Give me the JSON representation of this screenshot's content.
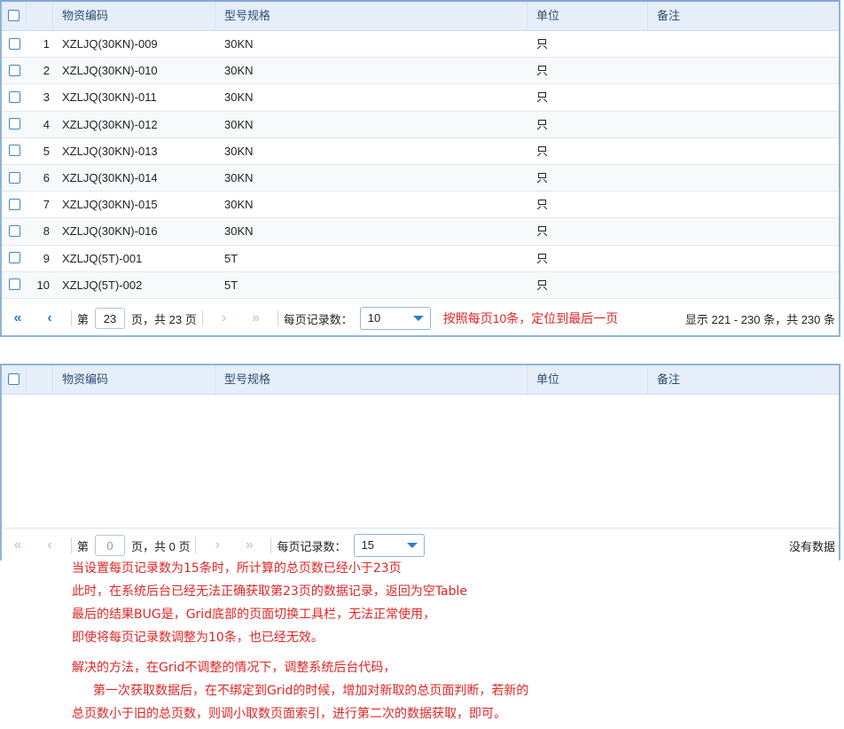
{
  "grid1": {
    "headers": {
      "code": "物资编码",
      "model": "型号规格",
      "unit": "单位",
      "remark": "备注"
    },
    "rows": [
      {
        "num": "1",
        "code": "XZLJQ(30KN)-009",
        "model": "30KN",
        "unit": "只",
        "remark": ""
      },
      {
        "num": "2",
        "code": "XZLJQ(30KN)-010",
        "model": "30KN",
        "unit": "只",
        "remark": ""
      },
      {
        "num": "3",
        "code": "XZLJQ(30KN)-011",
        "model": "30KN",
        "unit": "只",
        "remark": ""
      },
      {
        "num": "4",
        "code": "XZLJQ(30KN)-012",
        "model": "30KN",
        "unit": "只",
        "remark": ""
      },
      {
        "num": "5",
        "code": "XZLJQ(30KN)-013",
        "model": "30KN",
        "unit": "只",
        "remark": ""
      },
      {
        "num": "6",
        "code": "XZLJQ(30KN)-014",
        "model": "30KN",
        "unit": "只",
        "remark": ""
      },
      {
        "num": "7",
        "code": "XZLJQ(30KN)-015",
        "model": "30KN",
        "unit": "只",
        "remark": ""
      },
      {
        "num": "8",
        "code": "XZLJQ(30KN)-016",
        "model": "30KN",
        "unit": "只",
        "remark": ""
      },
      {
        "num": "9",
        "code": "XZLJQ(5T)-001",
        "model": "5T",
        "unit": "只",
        "remark": ""
      },
      {
        "num": "10",
        "code": "XZLJQ(5T)-002",
        "model": "5T",
        "unit": "只",
        "remark": ""
      }
    ],
    "pager": {
      "page_prefix": "第",
      "page_value": "23",
      "page_suffix": "页，共 23 页",
      "page_size_label": "每页记录数：",
      "page_size_value": "10",
      "annotation": "按照每页10条，定位到最后一页",
      "info": "显示 221 - 230 条，共 230 条"
    }
  },
  "grid2": {
    "headers": {
      "code": "物资编码",
      "model": "型号规格",
      "unit": "单位",
      "remark": "备注"
    },
    "pager": {
      "page_prefix": "第",
      "page_value": "0",
      "page_suffix": "页，共 0 页",
      "page_size_label": "每页记录数：",
      "page_size_value": "15",
      "info": "没有数据"
    }
  },
  "notes": {
    "line1": "当设置每页记录数为15条时，所计算的总页数已经小于23页",
    "line2": "此时，在系统后台已经无法正确获取第23页的数据记录，返回为空Table",
    "line3": "最后的结果BUG是，Grid底部的页面切换工具栏，无法正常使用，",
    "line4": "即使将每页记录数调整为10条，也已经无效。",
    "line5": "解决的方法，在Grid不调整的情况下，调整系统后台代码，",
    "line6": "第一次获取数据后，在不绑定到Grid的时候，增加对新取的总页面判断，若新的",
    "line7": "总页数小于旧的总页数，则调小取数页面索引，进行第二次的数据获取，即可。"
  },
  "icons": {
    "first": "double-chevron-left-icon",
    "prev": "chevron-left-icon",
    "next": "chevron-right-icon",
    "last": "double-chevron-right-icon",
    "dropdown": "caret-down-icon",
    "checkbox": "checkbox-icon"
  }
}
